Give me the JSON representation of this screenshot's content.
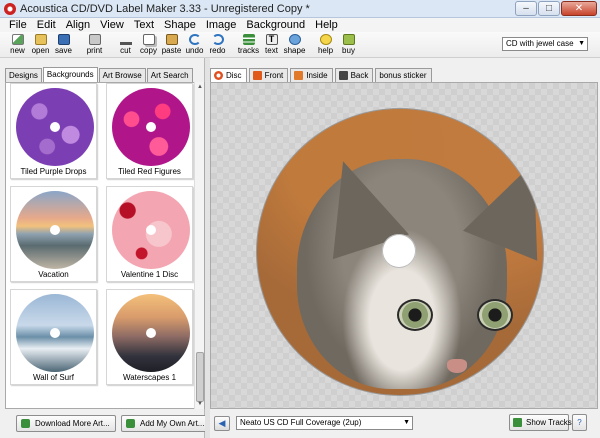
{
  "window": {
    "title": "Acoustica CD/DVD Label Maker 3.33 - Unregistered Copy *",
    "minimize": "–",
    "maximize": "□",
    "close": "✕"
  },
  "menu": [
    "File",
    "Edit",
    "Align",
    "View",
    "Text",
    "Shape",
    "Image",
    "Background",
    "Help"
  ],
  "toolbar": {
    "new": "new",
    "open": "open",
    "save": "save",
    "print": "print",
    "cut": "cut",
    "copy": "copy",
    "paste": "paste",
    "undo": "undo",
    "redo": "redo",
    "tracks": "tracks",
    "text": "text",
    "shape": "shape",
    "help": "help",
    "buy": "buy",
    "text_glyph": "T",
    "case_select": "CD with jewel case"
  },
  "left_tabs": [
    "Designs",
    "Backgrounds",
    "Art Browse",
    "Art Search"
  ],
  "left_active_tab": "Backgrounds",
  "backgrounds": [
    {
      "caption": "Tiled Purple Drops"
    },
    {
      "caption": "Tiled Red Figures"
    },
    {
      "caption": "Vacation"
    },
    {
      "caption": "Valentine 1 Disc"
    },
    {
      "caption": "Wall of Surf"
    },
    {
      "caption": "Waterscapes 1"
    }
  ],
  "left_buttons": {
    "download": "Download More Art...",
    "add": "Add My Own Art..."
  },
  "disc_tabs": [
    "Disc",
    "Front",
    "Inside",
    "Back",
    "bonus sticker"
  ],
  "disc_active_tab": "Disc",
  "bottom": {
    "layout_select": "Neato US CD Full Coverage (2up)",
    "show_tracks": "Show Tracks",
    "nav_arrow": "◀",
    "extra": "?"
  },
  "icons": {
    "select_arrow": "▼",
    "scroll_up": "▲",
    "scroll_down": "▼"
  }
}
